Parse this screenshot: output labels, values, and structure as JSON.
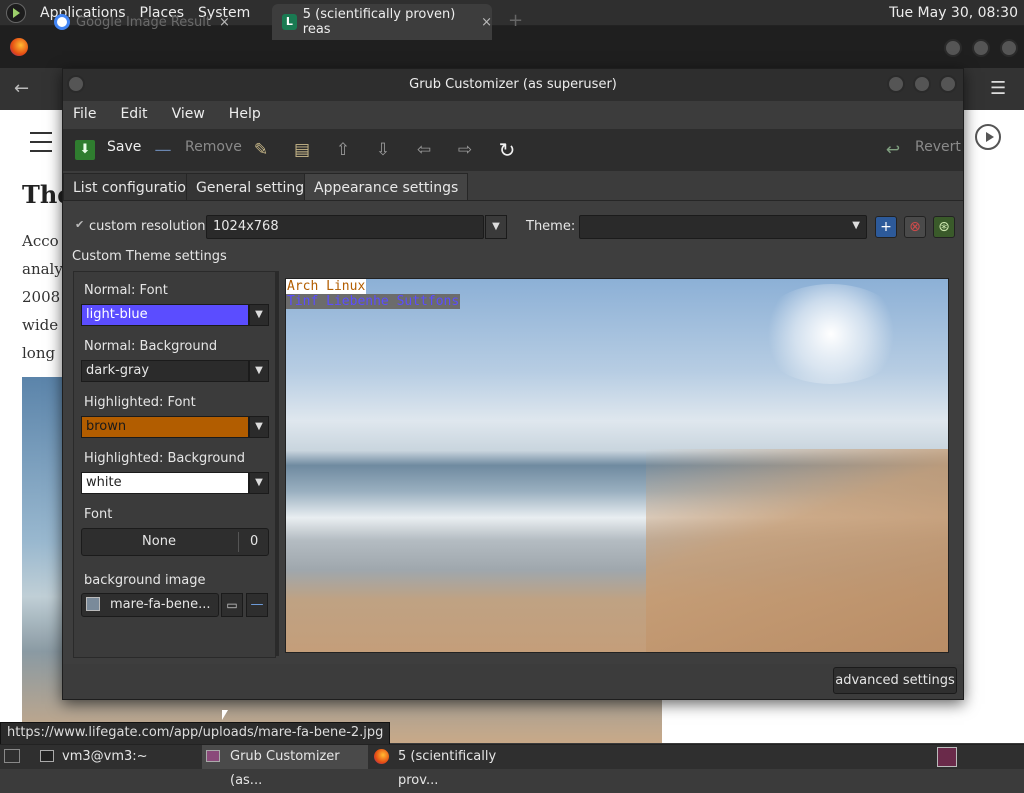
{
  "top_panel": {
    "menus": [
      "Applications",
      "Places",
      "System"
    ],
    "clock": "Tue May 30, 08:30"
  },
  "browser": {
    "tabs": [
      {
        "label": "Google Image Result",
        "icon": "google-icon"
      },
      {
        "label": "5 (scientifically proven) reas",
        "icon": "lifegate-icon",
        "icon_letter": "L"
      }
    ],
    "page": {
      "title_fragment": "The",
      "text_lines": [
        "Acco",
        "analy",
        "2008",
        "wide",
        "long"
      ]
    },
    "status_url": "https://www.lifegate.com/app/uploads/mare-fa-bene-2.jpg"
  },
  "dialog": {
    "title": "Grub Customizer (as superuser)",
    "menu": [
      "File",
      "Edit",
      "View",
      "Help"
    ],
    "toolbar": {
      "save": "Save",
      "remove": "Remove",
      "revert": "Revert"
    },
    "tabs": [
      "List configuration",
      "General settings",
      "Appearance settings"
    ],
    "active_tab": 2,
    "custom_resolution_label": "custom resolution:",
    "resolution_value": "1024x768",
    "theme_label": "Theme:",
    "theme_value": "",
    "section_title": "Custom Theme settings",
    "colors": [
      {
        "label": "Normal: Font",
        "value": "light-blue",
        "bg": "#5b4dff",
        "fg": "#ffffff"
      },
      {
        "label": "Normal: Background",
        "value": "dark-gray",
        "bg": "#2b2b2b",
        "fg": "#e6e6e6"
      },
      {
        "label": "Highlighted: Font",
        "value": "brown",
        "bg": "#b25d00",
        "fg": "#1a1a1a"
      },
      {
        "label": "Highlighted: Background",
        "value": "white",
        "bg": "#ffffff",
        "fg": "#222222"
      }
    ],
    "font_label": "Font",
    "font_value": "None",
    "font_size": "0",
    "bg_image_label": "background image",
    "bg_image_value": "mare-fa-bene...",
    "preview_lines": [
      "Arch Linux",
      "Tinf Liebenhe Suttfons"
    ],
    "advanced_button": "advanced settings"
  },
  "taskbar": {
    "items": [
      "vm3@vm3:~",
      "Grub Customizer (as...",
      "5 (scientifically prov..."
    ]
  }
}
